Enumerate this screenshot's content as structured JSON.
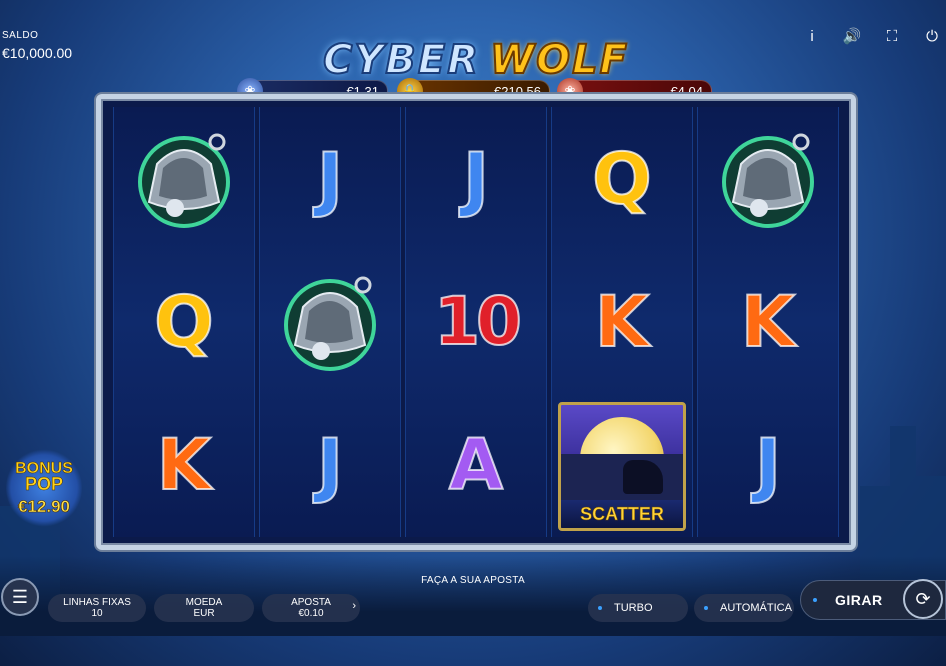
{
  "balance": {
    "label": "SALDO",
    "value": "€10,000.00"
  },
  "top_icons": [
    "info-icon",
    "sound-icon",
    "fullscreen-icon",
    "power-icon"
  ],
  "logo": {
    "word1": "CYBER",
    "word2": "WOLF"
  },
  "jackpots": [
    {
      "value": "€1,31",
      "icon": "wolf-badge-icon"
    },
    {
      "value": "€210.56",
      "icon": "lock-icon"
    },
    {
      "value": "€4,04",
      "icon": "wolf-badge-icon"
    }
  ],
  "reels": [
    [
      "BELL",
      "Q",
      "K"
    ],
    [
      "J",
      "BELL",
      "J"
    ],
    [
      "J",
      "10",
      "A"
    ],
    [
      "Q",
      "K",
      "SCATTER"
    ],
    [
      "BELL",
      "K",
      "J"
    ]
  ],
  "scatter_label": "SCATTER",
  "bonus_pop": {
    "line1": "BONUS",
    "line2": "POP",
    "value": "€12.90"
  },
  "place_bet": "FAÇA A SUA APOSTA",
  "controls": {
    "lines": {
      "label": "LINHAS FIXAS",
      "value": "10"
    },
    "coin": {
      "label": "MOEDA",
      "value": "EUR"
    },
    "bet": {
      "label": "APOSTA",
      "value": "€0.10"
    },
    "turbo": "TURBO",
    "auto": "AUTOMÁTICA",
    "spin": "GIRAR"
  },
  "colors": {
    "frame": "#c5d3e4",
    "accent": "#3aa0ff",
    "gold": "#ffc21a"
  }
}
